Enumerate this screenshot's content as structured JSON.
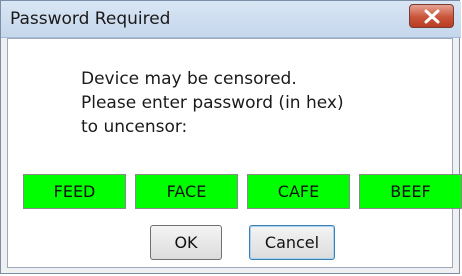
{
  "window": {
    "title": "Password Required"
  },
  "message": {
    "lines": [
      "Device may be censored.",
      "Please enter password (in hex)",
      "to uncensor:"
    ]
  },
  "password_fields": [
    "FEED",
    "FACE",
    "CAFE",
    "BEEF"
  ],
  "buttons": {
    "ok_label": "OK",
    "cancel_label": "Cancel"
  },
  "colors": {
    "field_background": "#00ff00",
    "close_button": "#c9543a",
    "titlebar": "#c5d7ec"
  },
  "icons": {
    "close": "close-icon"
  }
}
